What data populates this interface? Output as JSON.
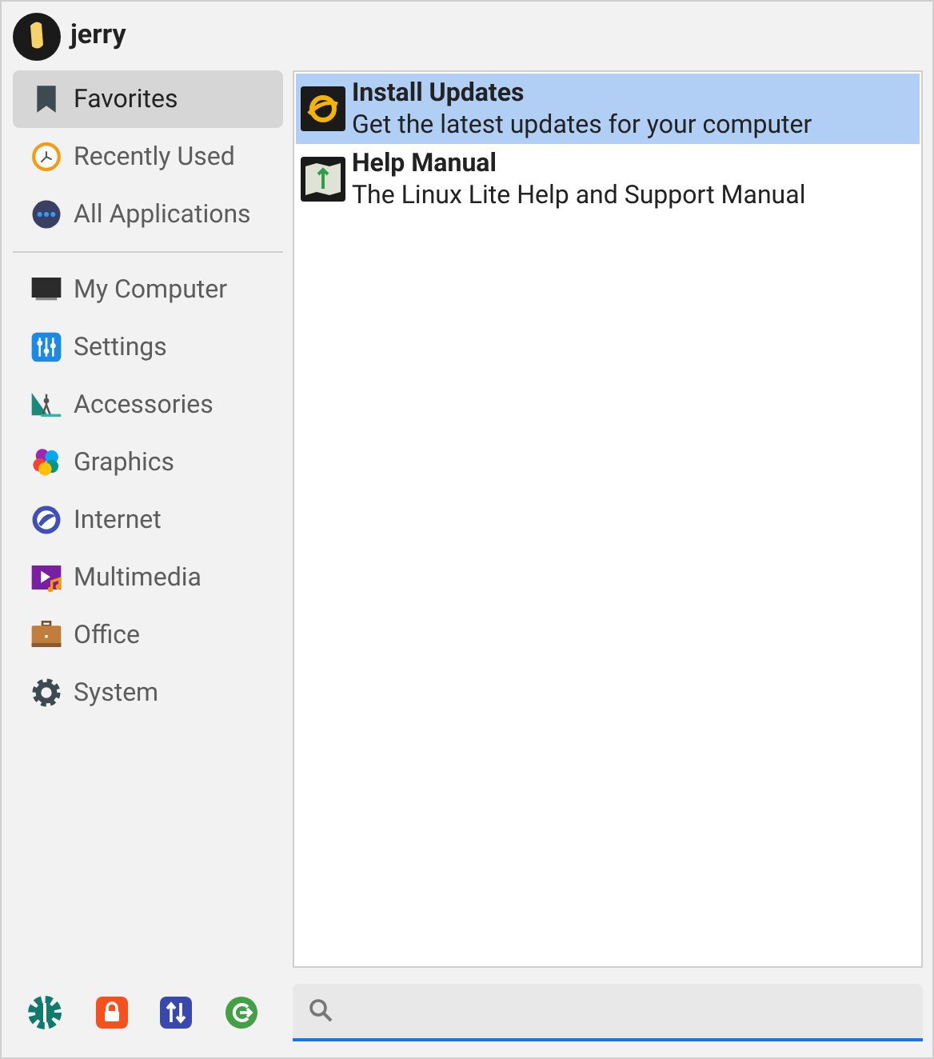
{
  "user": {
    "name": "jerry"
  },
  "sidebar": {
    "groups": [
      [
        {
          "label": "Favorites",
          "selected": true
        },
        {
          "label": "Recently Used",
          "selected": false
        },
        {
          "label": "All Applications",
          "selected": false
        }
      ],
      [
        {
          "label": "My Computer",
          "selected": false
        },
        {
          "label": "Settings",
          "selected": false
        },
        {
          "label": "Accessories",
          "selected": false
        },
        {
          "label": "Graphics",
          "selected": false
        },
        {
          "label": "Internet",
          "selected": false
        },
        {
          "label": "Multimedia",
          "selected": false
        },
        {
          "label": "Office",
          "selected": false
        },
        {
          "label": "System",
          "selected": false
        }
      ]
    ]
  },
  "apps": [
    {
      "name": "Install Updates",
      "description": "Get the latest updates for your computer",
      "selected": true
    },
    {
      "name": "Help Manual",
      "description": "The Linux Lite Help and Support Manual",
      "selected": false
    }
  ]
}
